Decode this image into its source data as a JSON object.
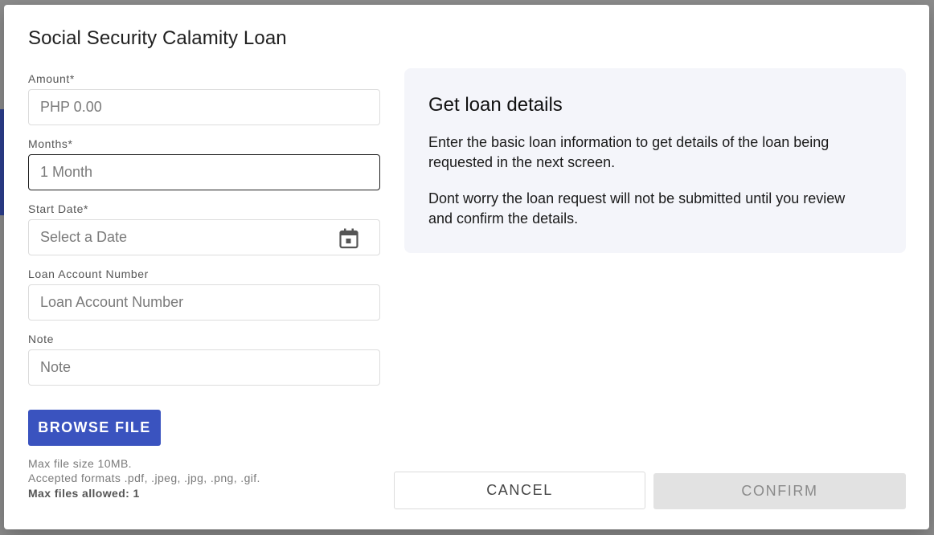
{
  "dialog": {
    "title": "Social Security Calamity Loan"
  },
  "form": {
    "amount": {
      "label": "Amount*",
      "placeholder": "PHP 0.00",
      "value": ""
    },
    "months": {
      "label": "Months*",
      "placeholder": "1 Month",
      "value": ""
    },
    "start_date": {
      "label": "Start Date*",
      "placeholder": "Select a Date",
      "value": "",
      "icon": "calendar-icon"
    },
    "loan_account_number": {
      "label": "Loan Account Number",
      "placeholder": "Loan Account Number",
      "value": ""
    },
    "note": {
      "label": "Note",
      "placeholder": "Note",
      "value": ""
    }
  },
  "upload": {
    "browse_label": "BROWSE FILE",
    "max_size": "Max file size 10MB.",
    "formats": "Accepted formats .pdf, .jpeg, .jpg, .png, .gif.",
    "max_files": "Max files allowed: 1"
  },
  "info": {
    "heading": "Get loan details",
    "paragraph1": "Enter the basic loan information to get details of the loan being requested in the next screen.",
    "paragraph2": "Dont worry the loan request will not be submitted until you review and confirm the details."
  },
  "actions": {
    "cancel_label": "CANCEL",
    "confirm_label": "CONFIRM"
  },
  "colors": {
    "primary": "#3a53bf",
    "info_bg": "#f4f5fa",
    "disabled_bg": "#e2e2e2"
  }
}
